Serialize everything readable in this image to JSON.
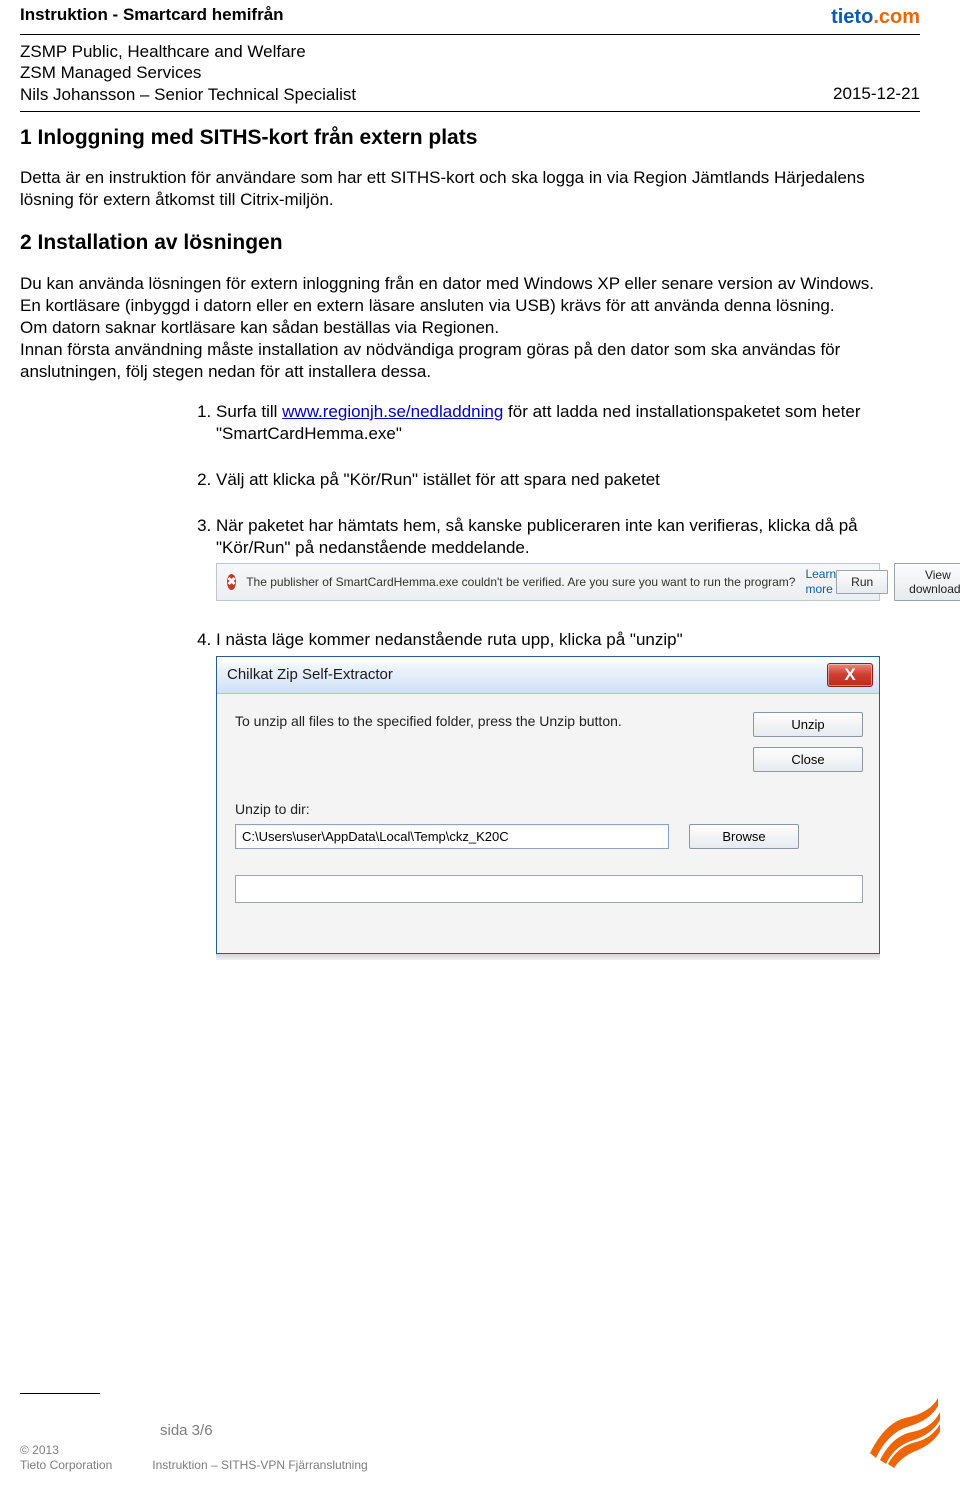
{
  "header": {
    "doc_title": "Instruktion - Smartcard hemifrån",
    "logo_tieto": "tieto",
    "logo_dotcom": ".com",
    "meta_line1": "ZSMP Public, Healthcare and Welfare",
    "meta_line2": "ZSM Managed Services",
    "meta_line3": "Nils Johansson – Senior Technical Specialist",
    "date": "2015-12-21"
  },
  "section1": {
    "heading": "1 Inloggning med SITHS-kort från extern plats",
    "para": "Detta är en instruktion för användare som har ett SITHS-kort och ska logga in via Region Jämtlands Härjedalens lösning för extern åtkomst till Citrix-miljön."
  },
  "section2": {
    "heading": "2 Installation av lösningen",
    "para": "Du kan använda lösningen för extern inloggning från en dator med Windows XP eller senare version av Windows.\nEn kortläsare (inbyggd i datorn eller en extern läsare ansluten via USB) krävs för att använda denna lösning.\nOm datorn saknar kortläsare kan sådan beställas via Regionen.\nInnan första användning måste installation av nödvändiga program göras på den dator som ska användas för anslutningen, följ stegen nedan för att installera dessa."
  },
  "steps": {
    "s1_pre": "Surfa till ",
    "s1_link": "www.regionjh.se/nedladdning",
    "s1_post": " för att ladda ned installationspaketet som heter \"SmartCardHemma.exe\"",
    "s2": "Välj att klicka på \"Kör/Run\" istället för att spara ned paketet",
    "s3": "När paketet har hämtats hem, så kanske publiceraren inte kan verifieras, klicka då på \"Kör/Run\" på nedanstående meddelande.",
    "s4": "I nästa läge kommer nedanstående ruta upp, klicka på \"unzip\""
  },
  "iebar": {
    "message": "The publisher of SmartCardHemma.exe couldn't be verified. Are you sure you want to run the program?",
    "learn": "Learn more",
    "run": "Run",
    "view": "View downloads",
    "close": "×"
  },
  "dialog": {
    "title": "Chilkat Zip Self-Extractor",
    "instruction": "To unzip all files to the specified folder, press the Unzip button.",
    "unzip": "Unzip",
    "close": "Close",
    "label": "Unzip to dir:",
    "path": "C:\\Users\\user\\AppData\\Local\\Temp\\ckz_K20C",
    "browse": "Browse",
    "x": "X"
  },
  "footer": {
    "page": "sida 3/6",
    "copy1": "© 2013",
    "copy2": "Tieto Corporation",
    "sub": "Instruktion – SITHS-VPN Fjärranslutning"
  }
}
